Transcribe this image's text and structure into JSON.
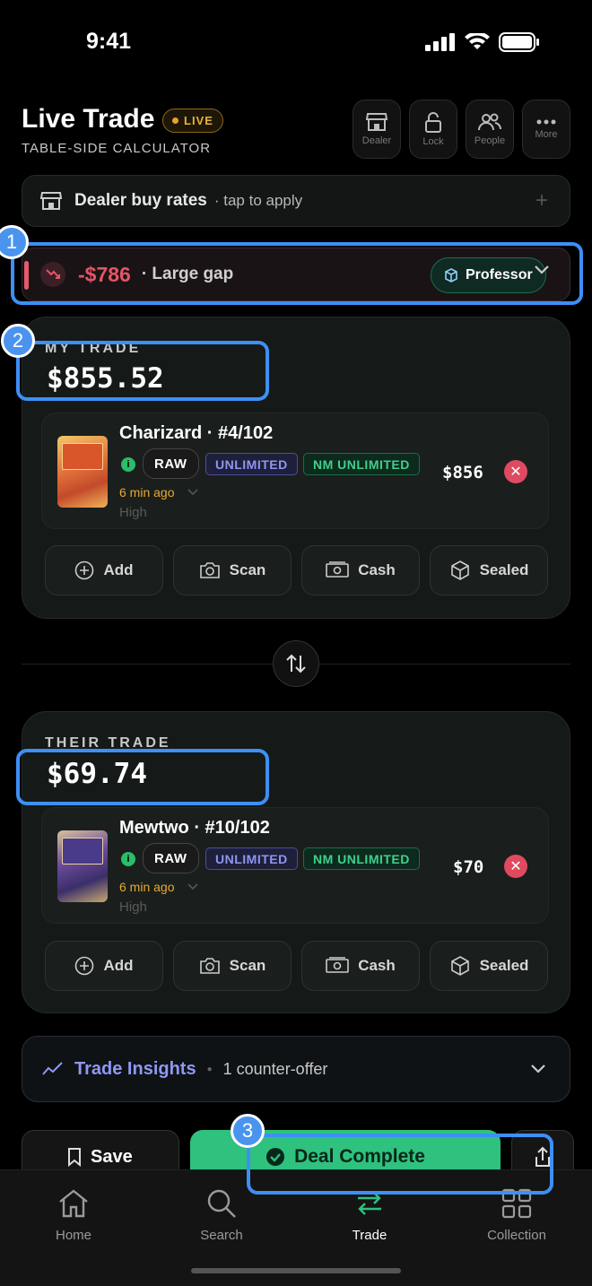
{
  "status": {
    "time": "9:41"
  },
  "header": {
    "title": "Live Trade",
    "live_badge": "LIVE",
    "subtitle": "TABLE-SIDE CALCULATOR",
    "buttons": [
      {
        "label": "Dealer",
        "icon": "store-icon"
      },
      {
        "label": "Lock",
        "icon": "lock-icon"
      },
      {
        "label": "People",
        "icon": "people-icon"
      },
      {
        "label": "More",
        "icon": "more-icon"
      }
    ]
  },
  "dealer_bar": {
    "title": "Dealer buy rates",
    "hint": "· tap to apply",
    "plus": "+"
  },
  "gap": {
    "amount": "-$786",
    "label": "· Large gap",
    "badge": "Professor"
  },
  "my_trade": {
    "label": "MY TRADE",
    "total": "$855.52",
    "item": {
      "name": "Charizard · #4/102",
      "raw": "RAW",
      "edition": "UNLIMITED",
      "condition": "NM UNLIMITED",
      "ago": "6 min ago",
      "tier": "High",
      "price": "$856"
    }
  },
  "their_trade": {
    "label": "THEIR TRADE",
    "total": "$69.74",
    "item": {
      "name": "Mewtwo · #10/102",
      "raw": "RAW",
      "edition": "UNLIMITED",
      "condition": "NM UNLIMITED",
      "ago": "6 min ago",
      "tier": "High",
      "price": "$70"
    }
  },
  "actions": {
    "add": "Add",
    "scan": "Scan",
    "cash": "Cash",
    "sealed": "Sealed"
  },
  "insights": {
    "title": "Trade Insights",
    "sub": "1 counter-offer"
  },
  "footer": {
    "save": "Save",
    "deal": "Deal Complete"
  },
  "tabs": [
    {
      "label": "Home"
    },
    {
      "label": "Search"
    },
    {
      "label": "Trade"
    },
    {
      "label": "Collection"
    }
  ],
  "overlays": [
    "1",
    "2",
    "3"
  ],
  "colors": {
    "accent_green": "#2ec27e",
    "gap_red": "#e45468",
    "live_amber": "#e8b23c",
    "insights_purple": "#8f98f5"
  }
}
